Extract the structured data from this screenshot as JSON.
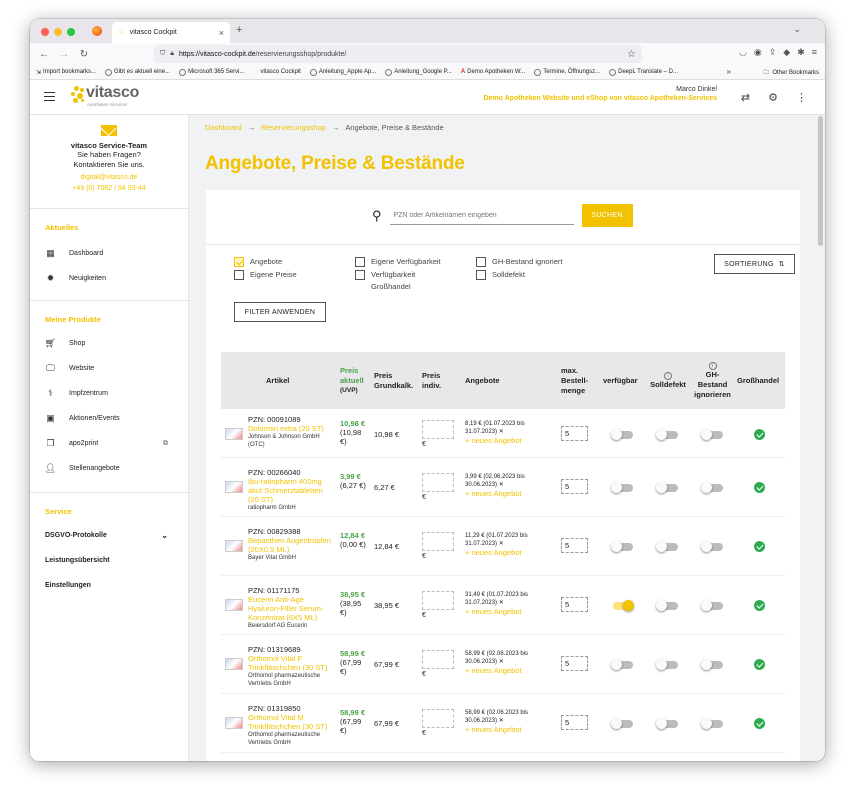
{
  "browser": {
    "tab_title": "vitasco Cockpit",
    "url_host": "https://vitasco-cockpit.de",
    "url_path": "/reservierungsshop/produkte/",
    "bookmarks": [
      "Import bookmarks...",
      "Gibt es aktuell eine...",
      "Microsoft 365 Servi...",
      "vitasco Cockpit",
      "Anleitung_Apple Ap...",
      "Anleitung_Google P...",
      "Demo Apotheken W...",
      "Termine, Öffnungsz...",
      "DeepL Translate – D..."
    ],
    "other_bookmarks": "Other Bookmarks"
  },
  "header": {
    "logo_text": "vitasco",
    "logo_sub": "Apotheken-Services",
    "user_name": "Marco Dinkel",
    "tagline": "Demo Apotheken Website und eShop von vitasco Apotheken-Services"
  },
  "sidebar": {
    "service": {
      "title": "vitasco Service-Team",
      "line1": "Sie haben Fragen?",
      "line2": "Kontaktieren Sie uns.",
      "email": "digital@vitasco.de",
      "phone": "+49 (0) 7062 / 94 93-44"
    },
    "aktuelles_title": "Aktuelles",
    "aktuelles": [
      {
        "label": "Dashboard"
      },
      {
        "label": "Neuigkeiten"
      }
    ],
    "produkte_title": "Meine Produkte",
    "produkte": [
      {
        "label": "Shop"
      },
      {
        "label": "Website"
      },
      {
        "label": "Impfzentrum"
      },
      {
        "label": "Aktionen/Events"
      },
      {
        "label": "apo2print"
      },
      {
        "label": "Stellenangebote"
      }
    ],
    "service_title": "Service",
    "service_items": [
      {
        "label": "DSGVO-Protokolle"
      },
      {
        "label": "Leistungsübersicht"
      },
      {
        "label": "Einstellungen"
      }
    ]
  },
  "breadcrumb": {
    "a": "Dashboard",
    "b": "Reservierungsshop",
    "sep": "→",
    "c": "Angebote, Preise & Bestände"
  },
  "page_title": "Angebote, Preise & Bestände",
  "search": {
    "placeholder": "PZN oder Artikelnamen eingeben",
    "button": "SUCHEN"
  },
  "filters": {
    "angebote": "Angebote",
    "eigene_preise": "Eigene Preise",
    "eigene_verf": "Eigene Verfügbarkeit",
    "verf_gross": "Verfügbarkeit Großhandel",
    "gh_ignoriert": "GH-Bestand ignoriert",
    "solldefekt": "Solldefekt",
    "angebote_checked": true,
    "sort_button": "SORTIERUNG",
    "apply_button": "FILTER ANWENDEN"
  },
  "table": {
    "headers": {
      "artikel": "Artikel",
      "preis_aktuell": "Preis aktuell",
      "uvp": "(UVP)",
      "grundkalk": "Preis Grundkalk.",
      "indiv": "Preis indiv.",
      "angebote": "Angebote",
      "max_menge": "max. Bestell-menge",
      "verfuegbar": "verfügbar",
      "solldefekt": "Solldefekt",
      "gh": "GH-Bestand ignorieren",
      "grosshandel": "Großhandel"
    },
    "new_offer": "+ neues Angebot",
    "euro": "€",
    "rows": [
      {
        "pzn": "PZN: 00091089",
        "name": "Dolormin extra (20 ST)",
        "mfr": "Johnson & Johnson GmbH (OTC)",
        "price": "10,98 €",
        "uvp": "(10,98 €)",
        "grund": "10,98 €",
        "offer": "8,19 € (01.07.2023 bis 31.07.2023) ✕",
        "qty": "5",
        "verfuegbar": false,
        "solldefekt": false,
        "gh": false,
        "grosshandel": true
      },
      {
        "pzn": "PZN: 00266040",
        "name": "Ibu-ratiopharm 400mg akut Schmerztabletten (20 ST)",
        "mfr": "ratiopharm GmbH",
        "price": "3,99 €",
        "uvp": "(6,27 €)",
        "grund": "6,27 €",
        "offer": "3,99 € (02.06.2023 bis 30.06.2023) ✕",
        "qty": "5",
        "verfuegbar": false,
        "solldefekt": false,
        "gh": false,
        "grosshandel": true
      },
      {
        "pzn": "PZN: 00829388",
        "name": "Bepanthen Augentropfen (20X0.5 ML)",
        "mfr": "Bayer Vital GmbH",
        "price": "12,84 €",
        "uvp": "(0,00 €)",
        "grund": "12,84 €",
        "offer": "11,29 € (01.07.2023 bis 31.07.2023) ✕",
        "qty": "5",
        "verfuegbar": false,
        "solldefekt": false,
        "gh": false,
        "grosshandel": true
      },
      {
        "pzn": "PZN: 01171175",
        "name": "Eucerin Anti-Age Hyaluron-Filler Serum-Konzentrat (6X5 ML)",
        "mfr": "Beiersdorf AG Eucerin",
        "price": "38,95 €",
        "uvp": "(38,95 €)",
        "grund": "38,95 €",
        "offer": "31,49 € (01.07.2023 bis 31.07.2023) ✕",
        "qty": "5",
        "verfuegbar": true,
        "solldefekt": false,
        "gh": false,
        "grosshandel": true
      },
      {
        "pzn": "PZN: 01319689",
        "name": "Orthomol Vital F Trinkfläschchen (30 ST)",
        "mfr": "Orthomol pharmazeutische Vertriebs GmbH",
        "price": "58,99 €",
        "uvp": "(67,99 €)",
        "grund": "67,99 €",
        "offer": "58,99 € (02.06.2023 bis 30.06.2023) ✕",
        "qty": "5",
        "verfuegbar": false,
        "solldefekt": false,
        "gh": false,
        "grosshandel": true
      },
      {
        "pzn": "PZN: 01319850",
        "name": "Orthomol Vital M Trinkfläschchen (30 ST)",
        "mfr": "Orthomol pharmazeutische Vertriebs GmbH",
        "price": "58,99 €",
        "uvp": "(67,99 €)",
        "grund": "67,99 €",
        "offer": "58,99 € (02.06.2023 bis 30.06.2023) ✕",
        "qty": "5",
        "verfuegbar": false,
        "solldefekt": false,
        "gh": false,
        "grosshandel": true
      }
    ]
  },
  "colors": {
    "accent": "#f2c200",
    "green": "#4aa24a",
    "ok": "#2eab4f"
  }
}
